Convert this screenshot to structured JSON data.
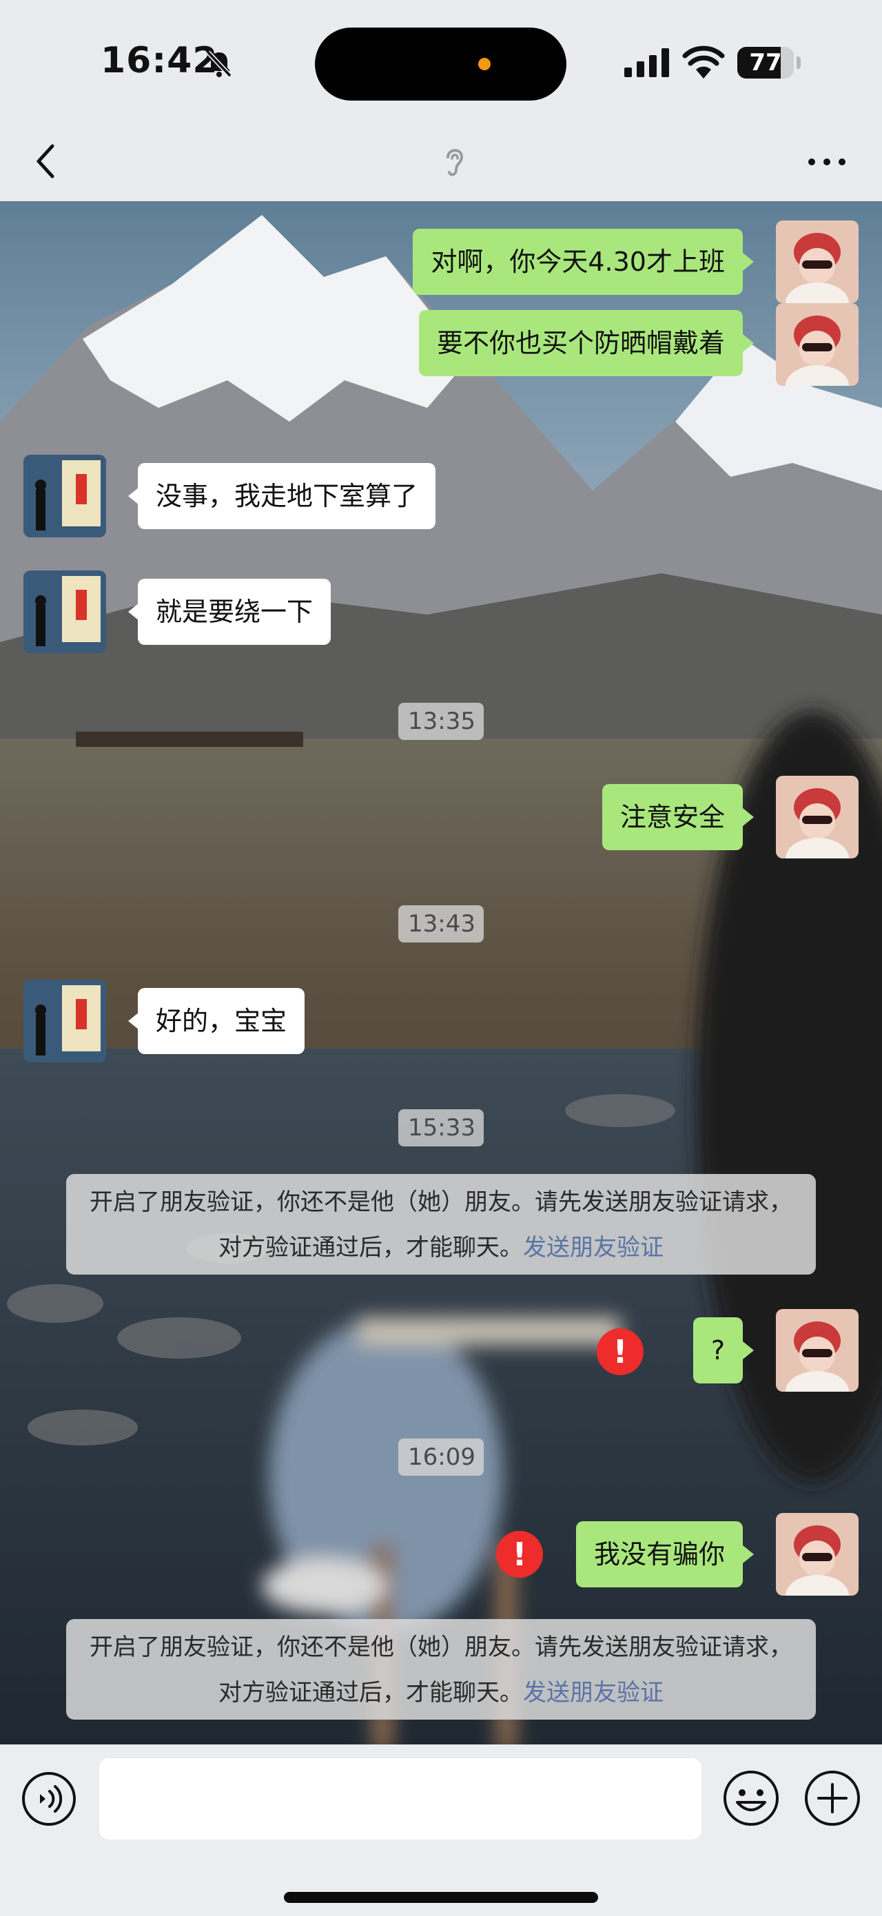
{
  "status_bar": {
    "time": "16:42",
    "battery": "77",
    "battery_level": 0.77
  },
  "nav": {
    "back_icon": "chevron-left-icon",
    "mode_icon": "ear-icon",
    "more_icon": "more-dots-icon"
  },
  "messages": [
    {
      "side": "out",
      "text": "对啊，你今天4.30才上班"
    },
    {
      "side": "out",
      "text": "要不你也买个防晒帽戴着"
    },
    {
      "side": "in",
      "text": "没事，我走地下室算了"
    },
    {
      "side": "in",
      "text": "就是要绕一下"
    },
    {
      "type": "time",
      "text": "13:35"
    },
    {
      "side": "out",
      "text": "注意安全"
    },
    {
      "type": "time",
      "text": "13:43"
    },
    {
      "side": "in",
      "text": "好的，宝宝"
    },
    {
      "type": "time",
      "text": "15:33"
    },
    {
      "type": "notice",
      "text": "开启了朋友验证，你还不是他（她）朋友。请先发送朋友验证请求，对方验证通过后，才能聊天。",
      "link": "发送朋友验证"
    },
    {
      "side": "out",
      "text": "?",
      "failed": true
    },
    {
      "type": "time",
      "text": "16:09"
    },
    {
      "side": "out",
      "text": "我没有骗你",
      "failed": true
    },
    {
      "type": "notice",
      "text": "开启了朋友验证，你还不是他（她）朋友。请先发送朋友验证请求，对方验证通过后，才能聊天。",
      "link": "发送朋友验证"
    }
  ],
  "error_mark": "!",
  "input_bar": {
    "voice_icon": "voice-icon",
    "message_value": "",
    "emoji_icon": "emoji-icon",
    "plus_icon": "plus-icon"
  },
  "colors": {
    "outgoing_bubble": "#a9e77d",
    "incoming_bubble": "#ffffff",
    "error_red": "#ee2c2c",
    "link_blue": "#5a74a6"
  }
}
